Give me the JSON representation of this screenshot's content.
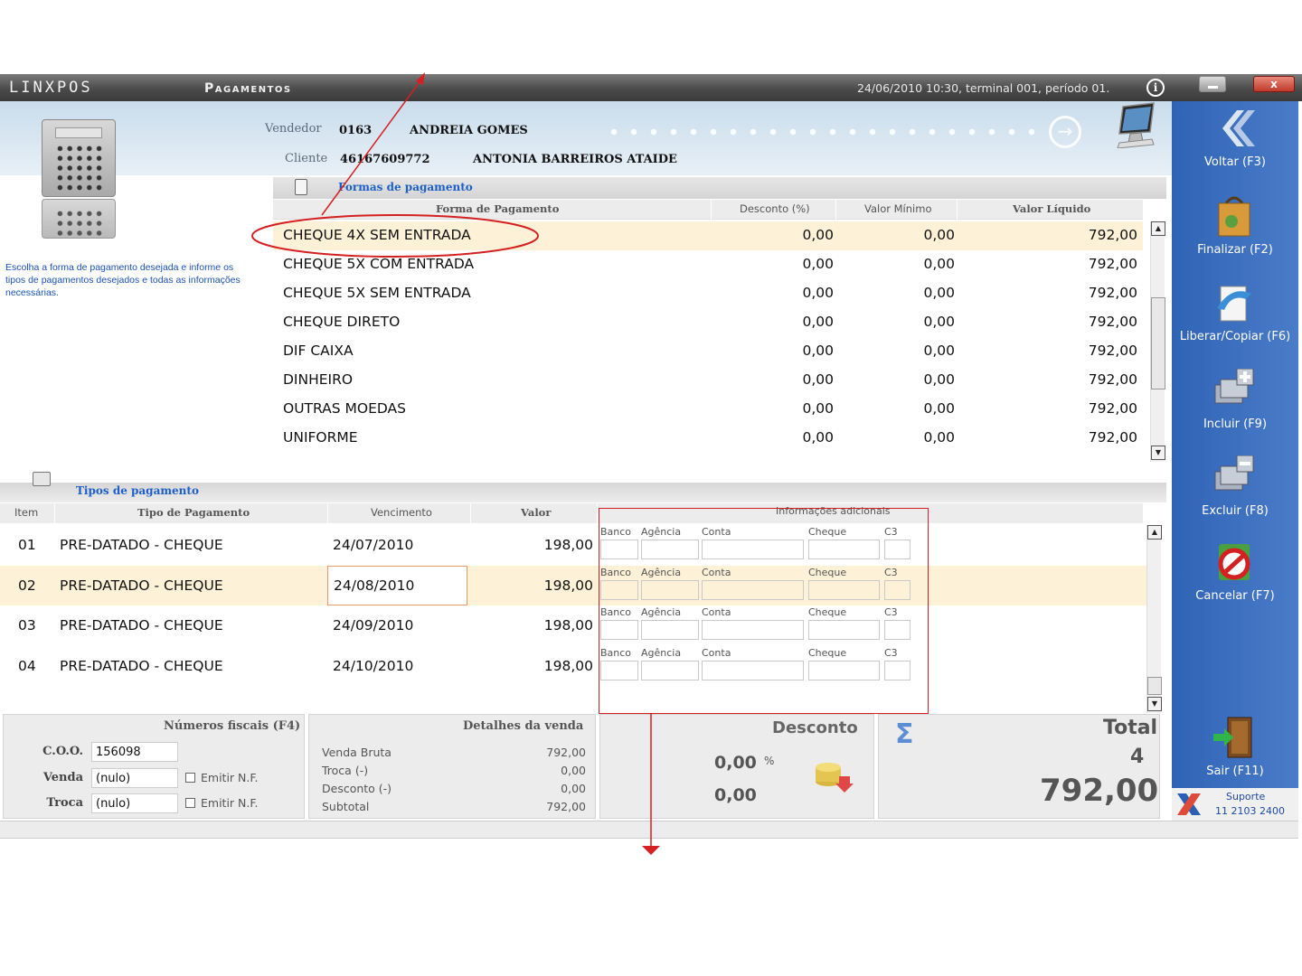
{
  "window": {
    "logo": "LINXPOS",
    "title": "Pagamentos",
    "status": "24/06/2010 10:30, terminal 001, período 01.",
    "info_label": "i",
    "close_label": "x"
  },
  "header": {
    "vendedor_label": "Vendedor",
    "vendedor_code": "0163",
    "vendedor_name": "ANDREIA GOMES",
    "cliente_label": "Cliente",
    "cliente_code": "46167609772",
    "cliente_name": "ANTONIA BARREIROS ATAIDE"
  },
  "help_text": "Escolha a forma de pagamento desejada e informe os tipos de pagamentos desejados e todas as informações necessárias.",
  "formas": {
    "title": "Formas de pagamento",
    "columns": [
      "Forma de Pagamento",
      "Desconto (%)",
      "Valor Mínimo",
      "Valor Líquido"
    ],
    "rows": [
      {
        "name": "CHEQUE 4X SEM ENTRADA",
        "desconto": "0,00",
        "minimo": "0,00",
        "liquido": "792,00"
      },
      {
        "name": "CHEQUE 5X COM ENTRADA",
        "desconto": "0,00",
        "minimo": "0,00",
        "liquido": "792,00"
      },
      {
        "name": "CHEQUE 5X SEM ENTRADA",
        "desconto": "0,00",
        "minimo": "0,00",
        "liquido": "792,00"
      },
      {
        "name": "CHEQUE DIRETO",
        "desconto": "0,00",
        "minimo": "0,00",
        "liquido": "792,00"
      },
      {
        "name": "DIF CAIXA",
        "desconto": "0,00",
        "minimo": "0,00",
        "liquido": "792,00"
      },
      {
        "name": "DINHEIRO",
        "desconto": "0,00",
        "minimo": "0,00",
        "liquido": "792,00"
      },
      {
        "name": "OUTRAS MOEDAS",
        "desconto": "0,00",
        "minimo": "0,00",
        "liquido": "792,00"
      },
      {
        "name": "UNIFORME",
        "desconto": "0,00",
        "minimo": "0,00",
        "liquido": "792,00"
      }
    ]
  },
  "tipos": {
    "title": "Tipos de pagamento",
    "columns": [
      "Item",
      "Tipo de Pagamento",
      "Vencimento",
      "Valor",
      "Informações adicionais"
    ],
    "info_labels": [
      "Banco",
      "Agência",
      "Conta",
      "Cheque",
      "C3"
    ],
    "rows": [
      {
        "item": "01",
        "tipo": "PRE-DATADO - CHEQUE",
        "vencimento": "24/07/2010",
        "valor": "198,00"
      },
      {
        "item": "02",
        "tipo": "PRE-DATADO - CHEQUE",
        "vencimento": "24/08/2010",
        "valor": "198,00"
      },
      {
        "item": "03",
        "tipo": "PRE-DATADO - CHEQUE",
        "vencimento": "24/09/2010",
        "valor": "198,00"
      },
      {
        "item": "04",
        "tipo": "PRE-DATADO - CHEQUE",
        "vencimento": "24/10/2010",
        "valor": "198,00"
      }
    ]
  },
  "fiscais": {
    "title": "Números fiscais (F4)",
    "coo_label": "C.O.O.",
    "coo_value": "156098",
    "venda_label": "Venda",
    "venda_value": "(nulo)",
    "troca_label": "Troca",
    "troca_value": "(nulo)",
    "emitir_label": "Emitir N.F."
  },
  "detalhes": {
    "title": "Detalhes da venda",
    "rows": [
      {
        "label": "Venda Bruta",
        "value": "792,00"
      },
      {
        "label": "Troca (-)",
        "value": "0,00"
      },
      {
        "label": "Desconto (-)",
        "value": "0,00"
      },
      {
        "label": "Subtotal",
        "value": "792,00"
      }
    ]
  },
  "desconto": {
    "title": "Desconto",
    "percent": "0,00",
    "percent_sign": "%",
    "value": "0,00"
  },
  "total": {
    "title": "Total",
    "count": "4",
    "value": "792,00",
    "sigma": "Σ"
  },
  "sidebar": {
    "items": [
      {
        "label": "Voltar (F3)"
      },
      {
        "label": "Finalizar (F2)"
      },
      {
        "label": "Liberar/Copiar (F6)"
      },
      {
        "label": "Incluir (F9)"
      },
      {
        "label": "Excluir (F8)"
      },
      {
        "label": "Cancelar (F7)"
      },
      {
        "label": "Sair (F11)"
      }
    ],
    "suporte_label": "Suporte",
    "suporte_phone": "11 2103 2400"
  },
  "colors": {
    "accent_blue": "#1c5fc9",
    "selected_row": "#fdf1d8",
    "annotation_red": "#d42020",
    "sidebar_blue": "#3a6dbd"
  }
}
